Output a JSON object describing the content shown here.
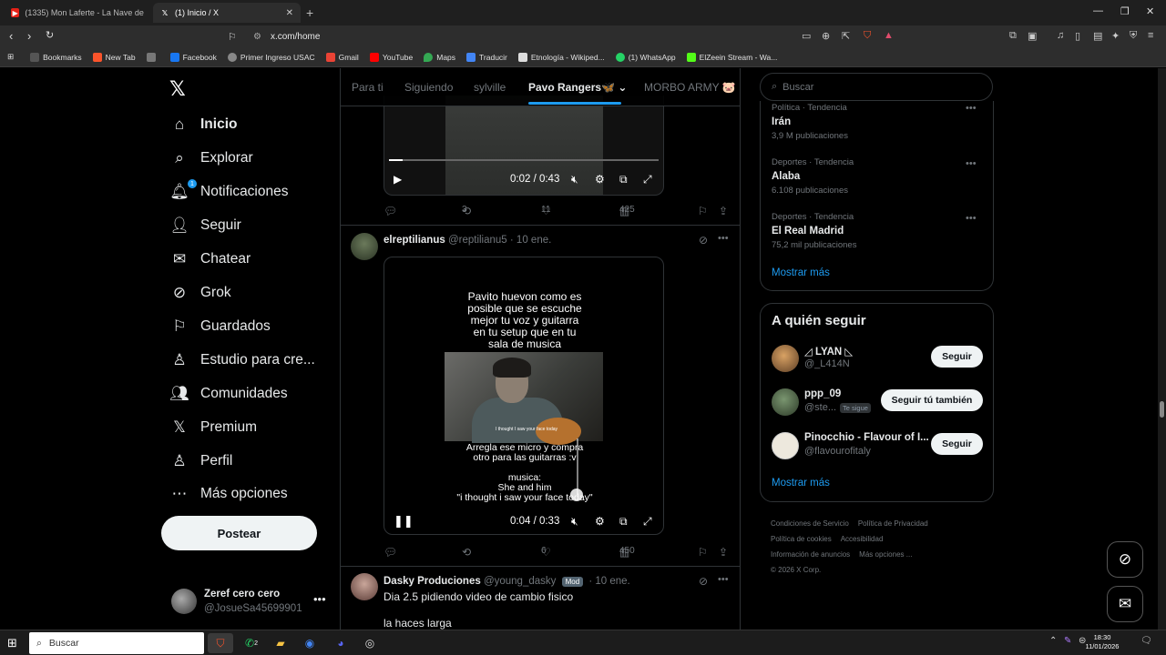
{
  "browser": {
    "tabs": [
      {
        "label": "(1335) Mon Laferte - La Nave del Olv",
        "icon": "youtube-icon"
      },
      {
        "label": "(1) Inicio / X",
        "icon": "x-icon"
      }
    ],
    "url": "x.com/home",
    "bookmarks": [
      {
        "label": "Bookmarks",
        "icon": "bookmarks-icon"
      },
      {
        "label": "New Tab",
        "icon": "brave-icon"
      },
      {
        "label": "",
        "icon": "image-icon"
      },
      {
        "label": "Facebook",
        "icon": "facebook-icon"
      },
      {
        "label": "Primer Ingreso USAC",
        "icon": "globe-icon"
      },
      {
        "label": "Gmail",
        "icon": "gmail-icon"
      },
      {
        "label": "YouTube",
        "icon": "youtube-icon"
      },
      {
        "label": "Maps",
        "icon": "maps-icon"
      },
      {
        "label": "Traducir",
        "icon": "translate-icon"
      },
      {
        "label": "Etnología - Wikiped...",
        "icon": "wikipedia-icon"
      },
      {
        "label": "(1) WhatsApp",
        "icon": "whatsapp-icon"
      },
      {
        "label": "ElZeein Stream - Wa...",
        "icon": "kick-icon"
      }
    ]
  },
  "nav": {
    "items": [
      {
        "label": "Inicio",
        "icon": "home-icon"
      },
      {
        "label": "Explorar",
        "icon": "search-icon"
      },
      {
        "label": "Notificaciones",
        "icon": "bell-icon",
        "badge": "1"
      },
      {
        "label": "Seguir",
        "icon": "follow-icon"
      },
      {
        "label": "Chatear",
        "icon": "mail-icon"
      },
      {
        "label": "Grok",
        "icon": "grok-icon"
      },
      {
        "label": "Guardados",
        "icon": "bookmark-icon"
      },
      {
        "label": "Estudio para cre...",
        "icon": "creator-icon"
      },
      {
        "label": "Comunidades",
        "icon": "communities-icon"
      },
      {
        "label": "Premium",
        "icon": "x-icon"
      },
      {
        "label": "Perfil",
        "icon": "person-icon"
      },
      {
        "label": "Más opciones",
        "icon": "more-circle-icon"
      }
    ],
    "post_button": "Postear",
    "account": {
      "name": "Zeref cero cero",
      "handle": "@JosueSa45699901"
    }
  },
  "feed": {
    "tabs": [
      "Para ti",
      "Siguiendo",
      "sylville",
      "Pavo Rangers🦋",
      "MORBO ARMY 🐷"
    ],
    "active_tab": "Pavo Rangers🦋",
    "post1": {
      "video_time": "0:02 / 0:43",
      "video_progress": 0.05,
      "stats": {
        "reposts": "3",
        "likes": "11",
        "views": "425"
      }
    },
    "post2": {
      "name": "elreptilianus",
      "handle": "@reptilianu5",
      "date": "· 10 ene.",
      "overlay_top": [
        "Pavito huevon como es",
        "posible que se escuche",
        "mejor tu voz y guitarra",
        "en tu setup que en tu",
        "sala de musica"
      ],
      "overlay_bottom": [
        "Arregla ese micro y compra",
        "otro para las guitarras :v",
        "",
        "musica:",
        "She and him",
        "\"i thought i saw your face today\""
      ],
      "photo_caption": "I thought I saw your face today",
      "video_time": "0:04 / 0:33",
      "stats": {
        "likes": "6",
        "views": "450"
      }
    },
    "post3": {
      "name": "Dasky Produciones",
      "handle": "@young_dasky",
      "badge": "Mod",
      "date": "· 10 ene.",
      "text1": "Dia 2.5 pidiendo video de cambio fisico",
      "text2": "la haces larga"
    }
  },
  "right": {
    "search_placeholder": "Buscar",
    "trends": [
      {
        "category": "Política · Tendencia",
        "name": "Irán",
        "posts": "3,9 M publicaciones"
      },
      {
        "category": "Deportes · Tendencia",
        "name": "Alaba",
        "posts": "6.108 publicaciones"
      },
      {
        "category": "Deportes · Tendencia",
        "name": "El Real Madrid",
        "posts": "75,2 mil publicaciones"
      }
    ],
    "show_more": "Mostrar más",
    "who_to_follow_title": "A quién seguir",
    "follow": [
      {
        "name": "◿ LYAN ◺",
        "handle": "@_L414N",
        "button": "Seguir",
        "avatar_color": "#c58a44"
      },
      {
        "name": "ppp_09",
        "handle": "@ste...",
        "follows_you": "Te sigue",
        "button": "Seguir tú también",
        "avatar_color": "#4c6a4a"
      },
      {
        "name": "Pinocchio - Flavour of I...",
        "handle": "@flavourofitaly",
        "button": "Seguir",
        "avatar_color": "#e8e4da"
      }
    ],
    "footer": [
      "Condiciones de Servicio",
      "Política de Privacidad",
      "Política de cookies",
      "Accesibilidad",
      "Información de anuncios",
      "Más opciones ...",
      "© 2026 X Corp."
    ]
  },
  "taskbar": {
    "search_placeholder": "Buscar",
    "time": "18:30",
    "date": "11/01/2026",
    "whatsapp_badge": "2"
  },
  "colors": {
    "accent": "#1d9bf0",
    "bg": "#000000",
    "border": "#2f3336",
    "muted": "#71767b"
  }
}
